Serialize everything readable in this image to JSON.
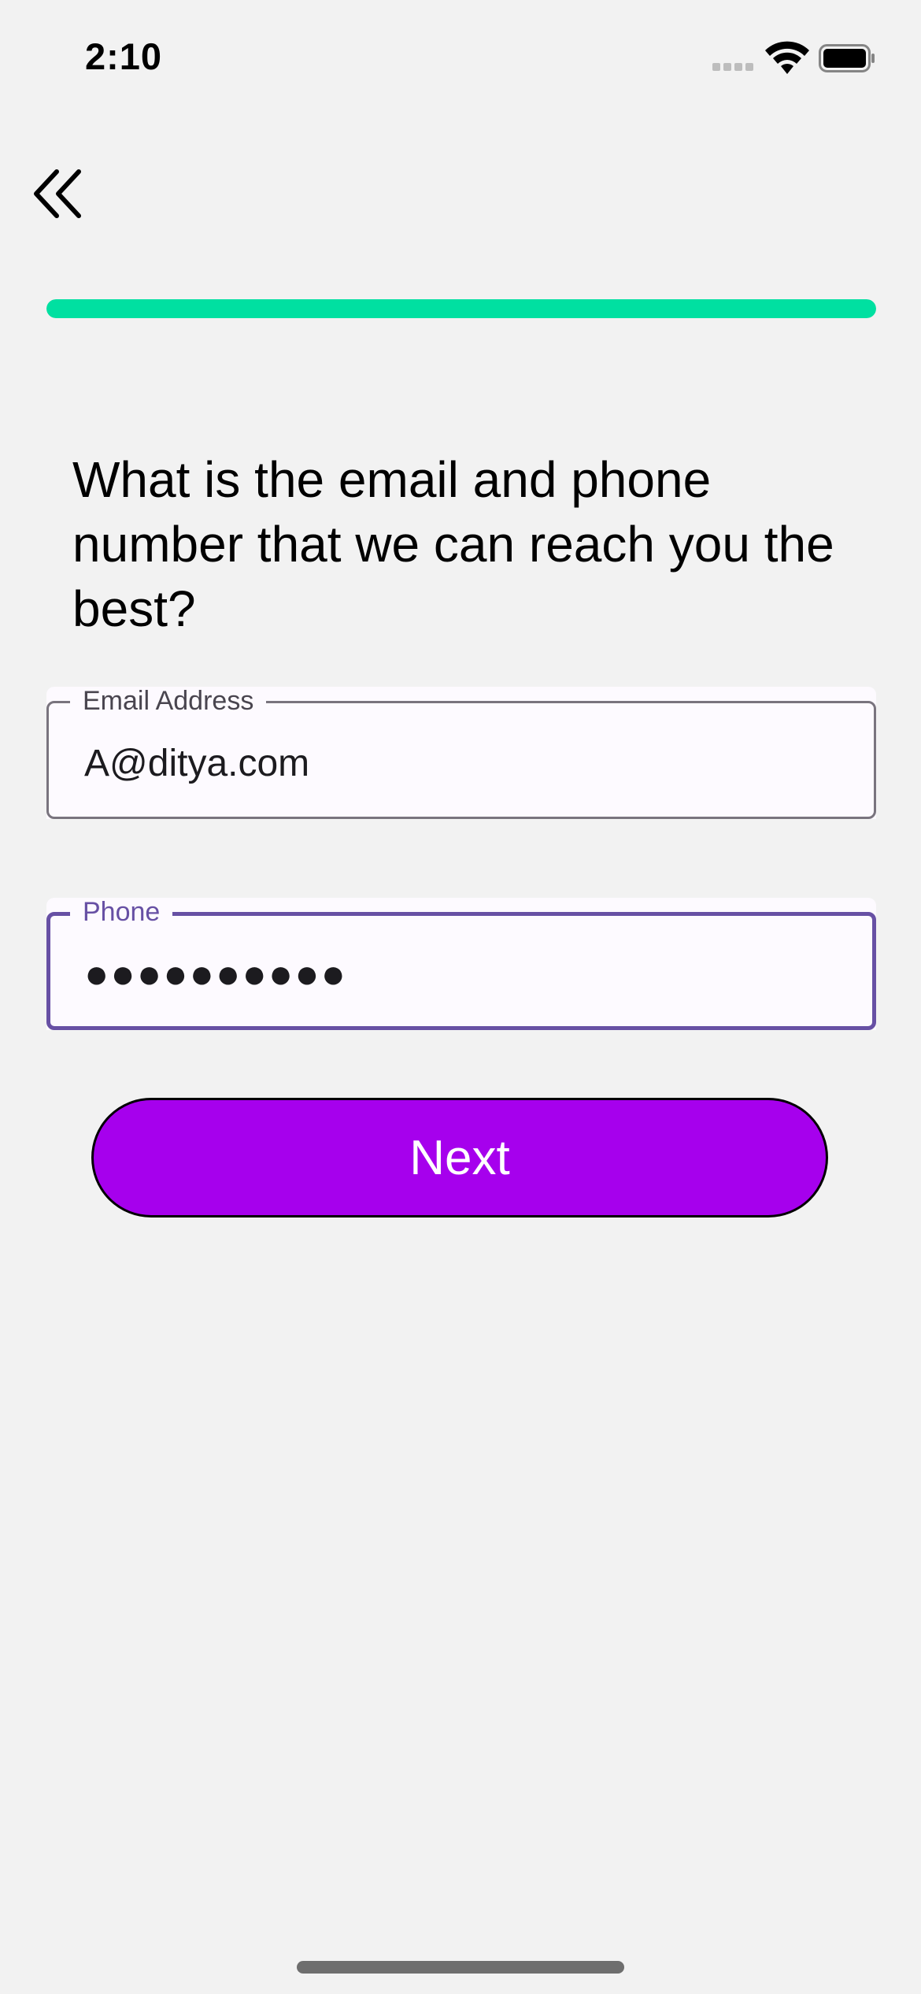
{
  "status_bar": {
    "time": "2:10",
    "icons": [
      "cellular-signal-icon",
      "wifi-icon",
      "battery-icon"
    ]
  },
  "nav": {
    "back_icon": "double-chevron-left-icon"
  },
  "progress": {
    "value": 1.0,
    "color": "#00e0a1"
  },
  "question": {
    "text": "What is the email and phone number that we can reach you the best?"
  },
  "form": {
    "email": {
      "label": "Email Address",
      "value": "A@ditya.com"
    },
    "phone": {
      "label": "Phone",
      "value": "●●●●●●●●●●",
      "focused": true
    }
  },
  "next_button": {
    "label": "Next",
    "color": "#a600ed"
  }
}
